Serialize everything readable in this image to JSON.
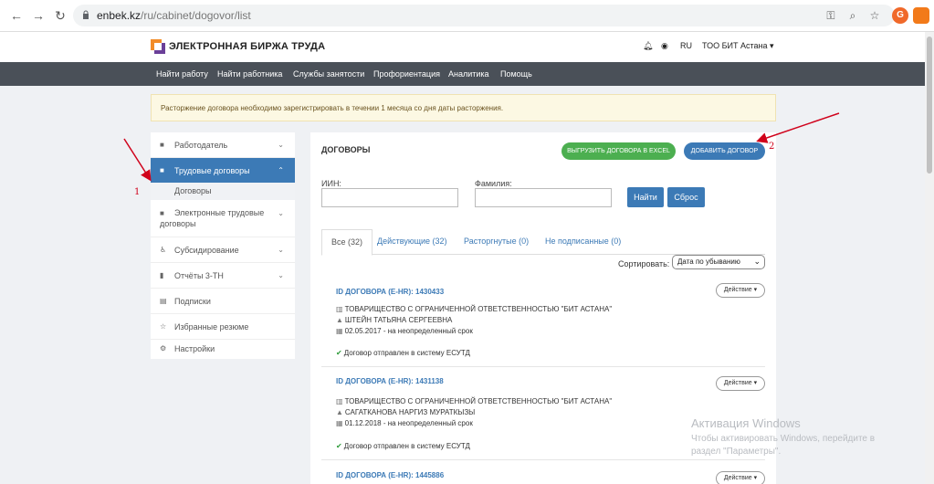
{
  "browser": {
    "url_host": "enbek.kz",
    "url_path": "/ru/cabinet/dogovor/list",
    "avatar_letter": "G"
  },
  "header": {
    "logo_text": "ЭЛЕКТРОННАЯ БИРЖА ТРУДА",
    "language": "RU",
    "user": "ТОО БИТ Астана ▾"
  },
  "nav": {
    "items": [
      "Найти работу",
      "Найти работника",
      "Службы занятости",
      "Профориентация",
      "Аналитика",
      "Помощь"
    ]
  },
  "alert": {
    "text": "Расторжение договора необходимо зарегистрировать в течении 1 месяца со дня даты расторжения."
  },
  "sidebar": {
    "items": [
      {
        "label": "Работодатель"
      },
      {
        "label": "Трудовые договоры"
      },
      {
        "label": "Договоры"
      },
      {
        "label": "Электронные трудовые договоры"
      },
      {
        "label": "Субсидирование"
      },
      {
        "label": "Отчёты 3-ТН"
      },
      {
        "label": "Подписки"
      },
      {
        "label": "Избранные резюме"
      },
      {
        "label": "Настройки"
      }
    ]
  },
  "main": {
    "title": "ДОГОВОРЫ",
    "export_button": "ВЫГРУЗИТЬ ДОГОВОРА В EXCEL",
    "add_button": "ДОБАВИТЬ ДОГОВОР",
    "iin_label": "ИИН:",
    "surname_label": "Фамилия:",
    "find_button": "Найти",
    "reset_button": "Сброс",
    "tabs": [
      "Все (32)",
      "Действующие (32)",
      "Расторгнутые (0)",
      "Не подписанные (0)"
    ],
    "sort_label": "Сортировать:",
    "sort_value": "Дата по убыванию",
    "action_label": "Действие ▾",
    "contracts": [
      {
        "id": "ID ДОГОВОРА (E-HR): 1430433",
        "company": "ТОВАРИЩЕСТВО С ОГРАНИЧЕННОЙ ОТВЕТСТВЕННОСТЬЮ \"БИТ АСТАНА\"",
        "person": "ШТЕЙН ТАТЬЯНА СЕРГЕЕВНА",
        "date": "02.05.2017 - на неопределенный срок",
        "status": "Договор отправлен в систему ЕСУТД"
      },
      {
        "id": "ID ДОГОВОРА (E-HR): 1431138",
        "company": "ТОВАРИЩЕСТВО С ОГРАНИЧЕННОЙ ОТВЕТСТВЕННОСТЬЮ \"БИТ АСТАНА\"",
        "person": "САГАТКАНОВА НАРГИЗ МУРАТКЫЗЫ",
        "date": "01.12.2018 - на неопределенный срок",
        "status": "Договор отправлен в систему ЕСУТД"
      },
      {
        "id": "ID ДОГОВОРА (E-HR): 1445886"
      }
    ]
  },
  "annotations": {
    "label1": "1",
    "label2": "2"
  },
  "watermark": {
    "title": "Активация Windows",
    "line1": "Чтобы активировать Windows, перейдите в",
    "line2": "раздел \"Параметры\"."
  },
  "colors": {
    "primary": "#3c7ab6",
    "green": "#4caf50",
    "nav_bg": "#4a5058",
    "annotation": "#d0021b"
  }
}
